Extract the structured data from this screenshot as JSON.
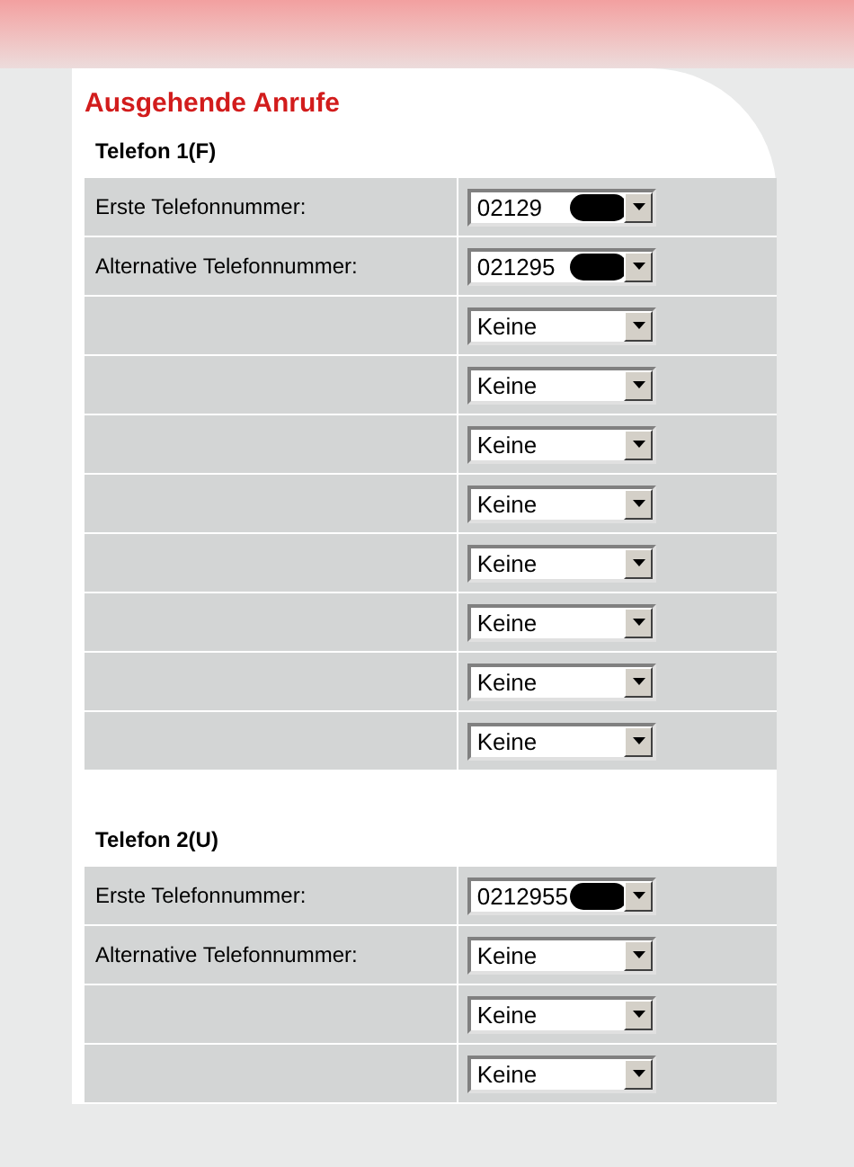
{
  "title": "Ausgehende Anrufe",
  "sections": [
    {
      "heading": "Telefon 1(F)",
      "rows": [
        {
          "label": "Erste Telefonnummer:",
          "value": "02129",
          "redacted": true
        },
        {
          "label": "Alternative Telefonnummer:",
          "value": "021295",
          "redacted": true
        },
        {
          "value": "Keine",
          "redacted": false
        },
        {
          "value": "Keine",
          "redacted": false
        },
        {
          "value": "Keine",
          "redacted": false
        },
        {
          "value": "Keine",
          "redacted": false
        },
        {
          "value": "Keine",
          "redacted": false
        },
        {
          "value": "Keine",
          "redacted": false
        },
        {
          "value": "Keine",
          "redacted": false
        },
        {
          "value": "Keine",
          "redacted": false
        }
      ]
    },
    {
      "heading": "Telefon 2(U)",
      "rows": [
        {
          "label": "Erste Telefonnummer:",
          "value": "0212955",
          "redacted": true
        },
        {
          "label": "Alternative Telefonnummer:",
          "value": "Keine",
          "redacted": false
        },
        {
          "value": "Keine",
          "redacted": false
        },
        {
          "value": "Keine",
          "redacted": false
        }
      ]
    }
  ]
}
